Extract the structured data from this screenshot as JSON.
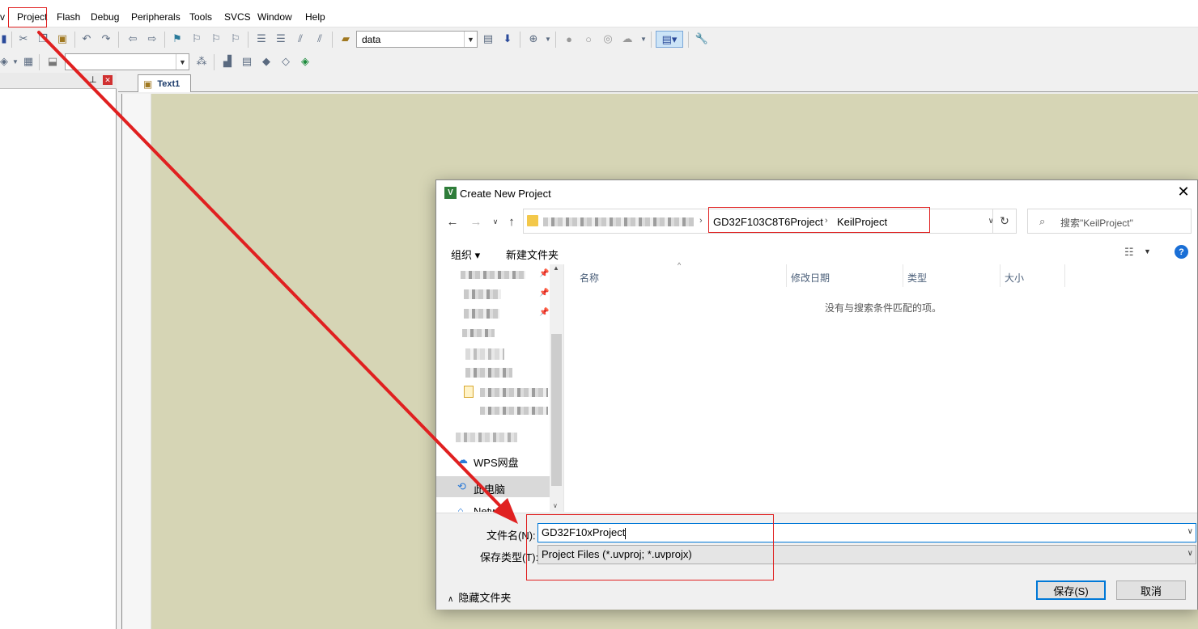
{
  "menubar": {
    "items": [
      "v",
      "Project",
      "Flash",
      "Debug",
      "Peripherals",
      "Tools",
      "SVCS",
      "Window",
      "Help"
    ]
  },
  "toolbar": {
    "target_combo": "data"
  },
  "editor": {
    "tab_label": "Text1"
  },
  "dialog": {
    "title": "Create New Project",
    "close_glyph": "✕",
    "breadcrumb": [
      "GD32F103C8T6Project",
      "KeilProject"
    ],
    "search_placeholder": "搜索\"KeilProject\"",
    "commands": {
      "organize": "组织 ▾",
      "new_folder": "新建文件夹"
    },
    "nav_pane": [
      {
        "label": "WPS网盘",
        "icon": "cloud-icon"
      },
      {
        "label": "此电脑",
        "icon": "computer-icon",
        "selected": true
      },
      {
        "label": "Network",
        "icon": "network-icon"
      }
    ],
    "columns": [
      "名称",
      "修改日期",
      "类型",
      "大小"
    ],
    "empty_message": "没有与搜索条件匹配的项。",
    "filename_label": "文件名(N):",
    "filename_value": "GD32F10xProject",
    "savetype_label": "保存类型(T):",
    "savetype_value": "Project Files (*.uvproj; *.uvprojx)",
    "hide_folders": "隐藏文件夹",
    "save_button": "保存(S)",
    "cancel_button": "取消"
  },
  "colors": {
    "annotation": "#e02020",
    "accent": "#0078d7",
    "editor_bg": "#d6d5b5"
  }
}
